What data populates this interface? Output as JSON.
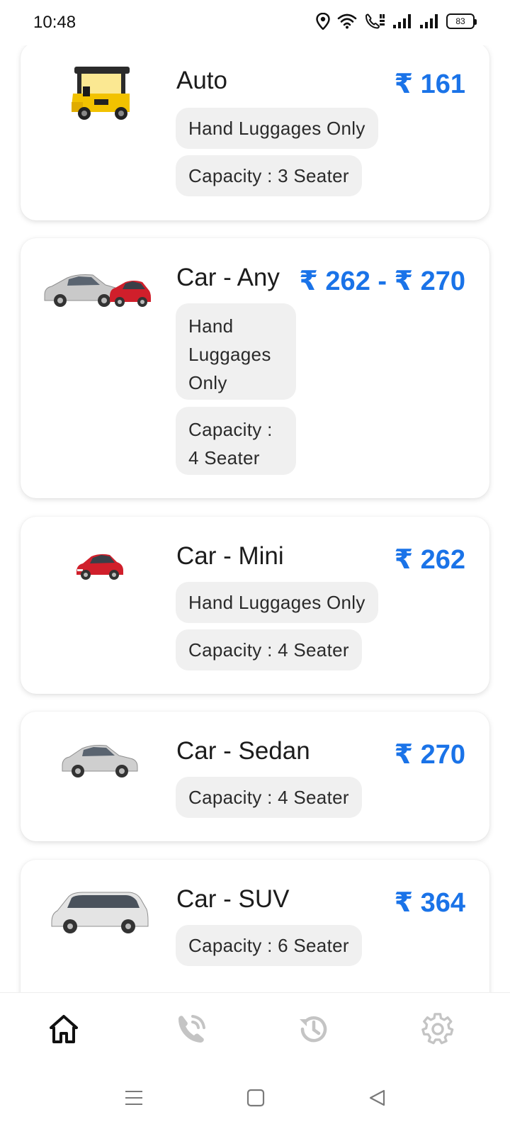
{
  "status_bar": {
    "time": "10:48",
    "battery": "83",
    "icons": [
      "location-icon",
      "wifi-icon",
      "wifi-calling-icon",
      "signal-icon",
      "signal-icon",
      "battery-icon"
    ]
  },
  "vehicles": [
    {
      "name": "Auto",
      "price": "₹ 161",
      "icon": "auto-rickshaw-image",
      "chips": [
        "Hand Luggages Only",
        "Capacity : 3 Seater"
      ]
    },
    {
      "name": "Car - Any",
      "price": "₹ 262 - ₹ 270",
      "icon": "cars-group-image",
      "chips": [
        "Hand Luggages Only",
        "Capacity : 4 Seater"
      ]
    },
    {
      "name": "Car - Mini",
      "price": "₹ 262",
      "icon": "hatchback-car-image",
      "chips": [
        "Hand Luggages Only",
        "Capacity : 4 Seater"
      ]
    },
    {
      "name": "Car - Sedan",
      "price": "₹ 270",
      "icon": "sedan-car-image",
      "chips": [
        "Capacity : 4 Seater"
      ]
    },
    {
      "name": "Car - SUV",
      "price": "₹ 364",
      "icon": "suv-car-image",
      "chips": [
        "Capacity : 6 Seater"
      ]
    }
  ],
  "bottom_nav": {
    "items": [
      "home-icon",
      "phone-call-icon",
      "history-icon",
      "settings-icon"
    ],
    "active": "home-icon"
  },
  "system_nav": [
    "menu-icon",
    "home-square-icon",
    "back-icon"
  ],
  "colors": {
    "accent": "#1a73e8",
    "chip_bg": "#f0f0f0",
    "nav_inactive": "#c4c4c4"
  }
}
